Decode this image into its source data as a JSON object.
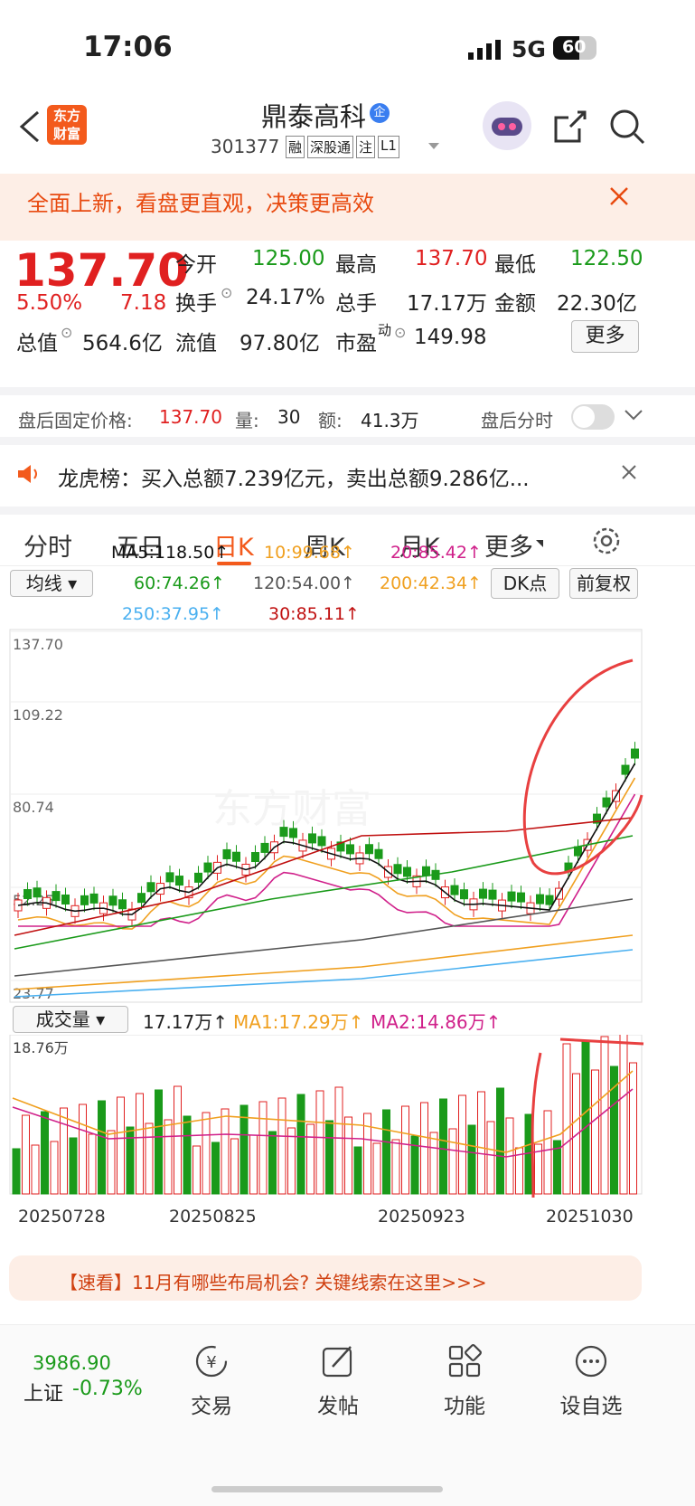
{
  "status": {
    "time": "17:06",
    "network": "5G",
    "battery": "60"
  },
  "nav": {
    "title": "鼎泰高科",
    "badge": "企",
    "code": "301377",
    "tags": [
      "融",
      "深股通",
      "注",
      "L1"
    ],
    "logo_line1": "东方",
    "logo_line2": "财富"
  },
  "banner": {
    "text": "全面上新，看盘更直观，决策更高效"
  },
  "quote": {
    "price": "137.70",
    "pct": "5.50%",
    "chg": "7.18",
    "row1": [
      {
        "label": "今开",
        "value": "125.00"
      },
      {
        "label": "最高",
        "value": "137.70"
      },
      {
        "label": "最低",
        "value": "122.50"
      }
    ],
    "row2": [
      {
        "label": "换手",
        "value": "24.17%"
      },
      {
        "label": "总手",
        "value": "17.17万"
      },
      {
        "label": "金额",
        "value": "22.30亿"
      }
    ],
    "row3": [
      {
        "label": "总值",
        "value": "564.6亿"
      },
      {
        "label": "流值",
        "value": "97.80亿"
      },
      {
        "label": "市盈",
        "sup": "动",
        "value": "149.98"
      }
    ],
    "more": "更多"
  },
  "after_hours": {
    "label": "盘后固定价格:",
    "price": "137.70",
    "vol_label": "量:",
    "vol": "30",
    "amt_label": "额:",
    "amt": "41.3万",
    "toggle_label": "盘后分时"
  },
  "lhb": {
    "text": "龙虎榜：买入总额7.239亿元，卖出总额9.286亿..."
  },
  "tabs": [
    "分时",
    "五日",
    "日K",
    "周K",
    "月K",
    "更多"
  ],
  "ma": {
    "select": "均线",
    "dk": "DK点",
    "fq": "前复权",
    "items": [
      {
        "t": "MA5:118.50↑",
        "c": "#111"
      },
      {
        "t": "10:99.68↑",
        "c": "#f0a020"
      },
      {
        "t": "20:85.42↑",
        "c": "#d0208a"
      },
      {
        "t": "60:74.26↑",
        "c": "#1a9a1a"
      },
      {
        "t": "120:54.00↑",
        "c": "#555"
      },
      {
        "t": "200:42.34↑",
        "c": "#f0a020"
      },
      {
        "t": "250:37.95↑",
        "c": "#4ab0f0"
      },
      {
        "t": "30:85.11↑",
        "c": "#c01010"
      }
    ]
  },
  "price_axis": [
    "137.70",
    "109.22",
    "80.74",
    "52.25",
    "23.77"
  ],
  "volume": {
    "select": "成交量",
    "current": "17.17万↑",
    "ma1": "MA1:17.29万↑",
    "ma2": "MA2:14.86万↑",
    "max": "18.76万"
  },
  "dates": [
    "20250728",
    "20250825",
    "20250923",
    "20251030"
  ],
  "watermark": "东方财富",
  "promo": "【速看】11月有哪些布局机会? 关键线索在这里>>>",
  "bottom": {
    "index_value": "3986.90",
    "index_name": "上证",
    "index_pct": "-0.73%",
    "items": [
      "交易",
      "发帖",
      "功能",
      "设自选"
    ]
  },
  "chart_data": {
    "type": "candlestick",
    "last_close": 137.7,
    "high": 137.7,
    "low": 122.5,
    "open": 125.0,
    "y_range": [
      23.77,
      137.7
    ],
    "volume_max": "18.76万"
  }
}
